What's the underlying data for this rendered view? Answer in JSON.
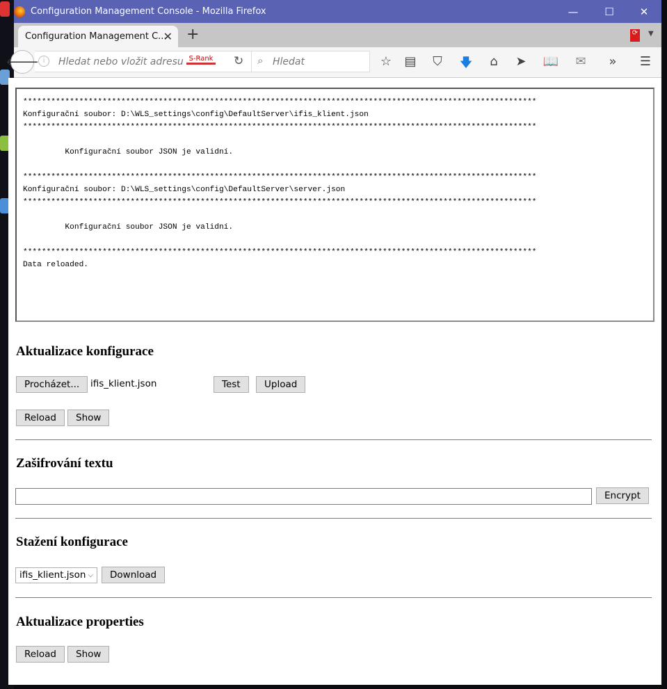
{
  "window": {
    "title": "Configuration Management Console - Mozilla Firefox",
    "minimize": "—",
    "maximize": "☐",
    "close": "✕"
  },
  "tab": {
    "label": "Configuration Management C...",
    "close": "✕",
    "new_tab": "+"
  },
  "nav": {
    "url_placeholder": "Hledat nebo vložit adresu",
    "srank": "S-Rank",
    "search_placeholder": "Hledat",
    "overflow": "»"
  },
  "log": {
    "lines": [
      "**************************************************************************************************************",
      "Konfigurační soubor: D:\\WLS_settings\\config\\DefaultServer\\ifis_klient.json",
      "**************************************************************************************************************",
      "",
      "         Konfigurační soubor JSON je validní.",
      "",
      "**************************************************************************************************************",
      "Konfigurační soubor: D:\\WLS_settings\\config\\DefaultServer\\server.json",
      "**************************************************************************************************************",
      "",
      "         Konfigurační soubor JSON je validní.",
      "",
      "**************************************************************************************************************",
      "Data reloaded."
    ]
  },
  "config_update": {
    "heading": "Aktualizace konfigurace",
    "browse": "Procházet...",
    "file": "ifis_klient.json",
    "test": "Test",
    "upload": "Upload",
    "reload": "Reload",
    "show": "Show"
  },
  "encrypt": {
    "heading": "Zašifrování textu",
    "value": "",
    "button": "Encrypt"
  },
  "download": {
    "heading": "Stažení konfigurace",
    "selected": "ifis_klient.json",
    "button": "Download"
  },
  "properties": {
    "heading": "Aktualizace properties",
    "reload": "Reload",
    "show": "Show"
  }
}
